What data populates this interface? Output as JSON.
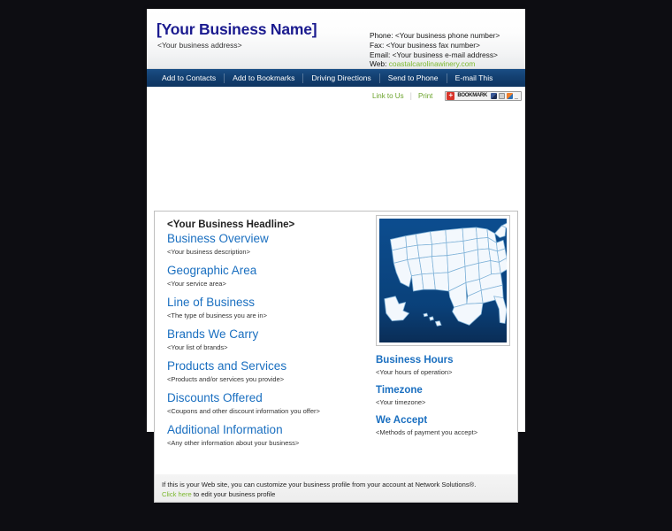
{
  "header": {
    "business_name": "[Your Business Name]",
    "business_address": "<Your business address>",
    "contact": {
      "phone_label": "Phone:",
      "phone_value": "<Your business phone number>",
      "fax_label": "Fax:",
      "fax_value": "<Your business fax number>",
      "email_label": "Email:",
      "email_value": "<Your business e-mail address>",
      "web_label": "Web:",
      "web_value": "coastalcarolinawinery.com"
    }
  },
  "nav": {
    "items": [
      {
        "label": "Add to Contacts"
      },
      {
        "label": "Add to Bookmarks"
      },
      {
        "label": "Driving Directions"
      },
      {
        "label": "Send to Phone"
      },
      {
        "label": "E-mail This"
      }
    ]
  },
  "toolbar": {
    "link_to_us": "Link to Us",
    "separator": "|",
    "print": "Print",
    "bookmark_widget": {
      "plus": "+",
      "label": "BOOKMARK",
      "icons": [
        "facebook-icon",
        "blank-icon",
        "delicious-icon",
        "more-icon"
      ],
      "more": "_"
    }
  },
  "main": {
    "headline": "<Your Business Headline>",
    "left_sections": [
      {
        "title": "Business Overview",
        "placeholder": "<Your business description>"
      },
      {
        "title": "Geographic Area",
        "placeholder": "<Your service area>"
      },
      {
        "title": "Line of Business",
        "placeholder": "<The type of business you are in>"
      },
      {
        "title": "Brands We Carry",
        "placeholder": "<Your list of brands>"
      },
      {
        "title": "Products and Services",
        "placeholder": "<Products and/or services you provide>"
      },
      {
        "title": "Discounts Offered",
        "placeholder": "<Coupons and other discount information you offer>"
      },
      {
        "title": "Additional Information",
        "placeholder": "<Any other information about your business>"
      }
    ],
    "map": {
      "name": "united-states-map",
      "background_color": "#0a417a",
      "states_color": "#f2f7fc"
    },
    "right_sections": [
      {
        "title": "Business Hours",
        "placeholder": "<Your hours of operation>"
      },
      {
        "title": "Timezone",
        "placeholder": "<Your timezone>"
      },
      {
        "title": "We Accept",
        "placeholder": "<Methods of payment you accept>"
      }
    ]
  },
  "footer": {
    "line1": "If this is your Web site, you can customize your business profile from your account at Network Solutions®.",
    "link_text": "Click here",
    "line2_rest": " to edit your business profile"
  },
  "colors": {
    "page_background": "#0d0d12",
    "nav_bar": "#134071",
    "heading_blue": "#1a6fc0",
    "business_name": "#1b1b8f",
    "green_link": "#7cb82f",
    "map_blue": "#0a417a"
  }
}
